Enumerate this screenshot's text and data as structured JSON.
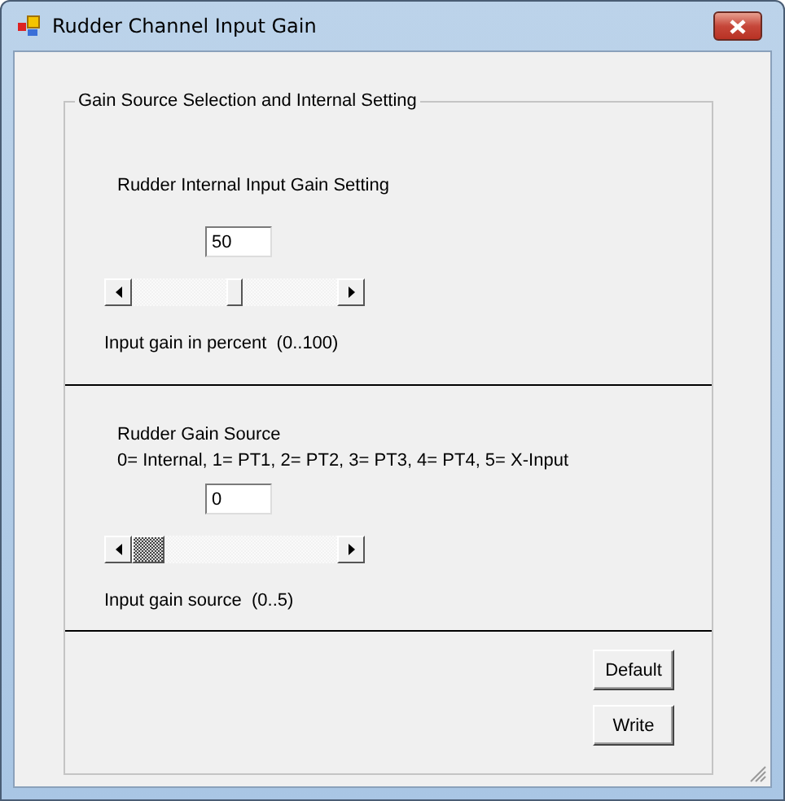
{
  "window": {
    "title": "Rudder Channel Input Gain"
  },
  "group": {
    "title": "Gain Source Selection and Internal Setting"
  },
  "sections": [
    {
      "heading": "Rudder Internal Input Gain Setting",
      "value": "50",
      "scrollbar": {
        "focused": false
      },
      "caption": "Input gain in percent  (0..100)"
    },
    {
      "heading": "Rudder Gain Source",
      "legend": "0= Internal, 1= PT1, 2= PT2, 3= PT3, 4= PT4, 5= X-Input",
      "value": "0",
      "scrollbar": {
        "focused": true
      },
      "caption": "Input gain source  (0..5)"
    }
  ],
  "buttons": [
    "Default",
    "Write"
  ]
}
